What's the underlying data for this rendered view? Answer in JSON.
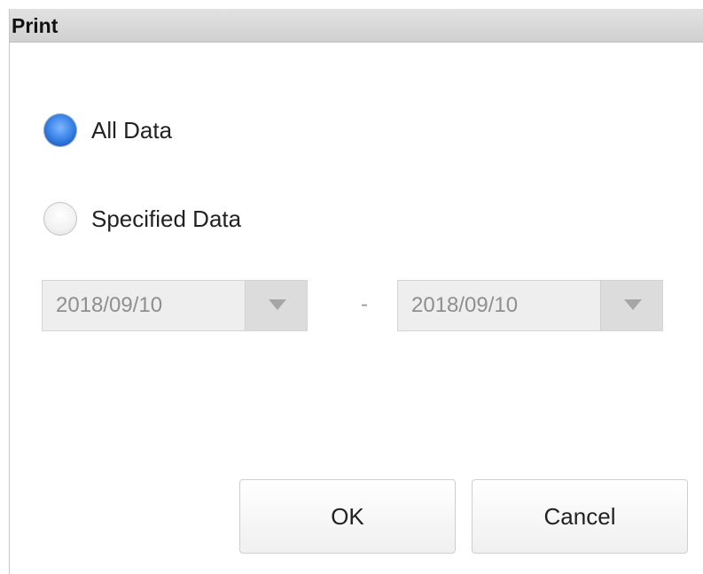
{
  "dialog": {
    "title": "Print"
  },
  "options": {
    "all_data": {
      "label": "All Data",
      "checked": true
    },
    "specified_data": {
      "label": "Specified Data",
      "checked": false
    }
  },
  "date_range": {
    "start": "2018/09/10",
    "separator": "-",
    "end": "2018/09/10",
    "enabled": false
  },
  "buttons": {
    "ok_label": "OK",
    "cancel_label": "Cancel"
  },
  "colors": {
    "title_bar": "#d6d6d6",
    "radio_selected": "#3d86e8",
    "disabled_field": "#eeeeee",
    "disabled_text": "#8f8f8f"
  },
  "icons": {
    "dropdown": "chevron-down-icon"
  }
}
